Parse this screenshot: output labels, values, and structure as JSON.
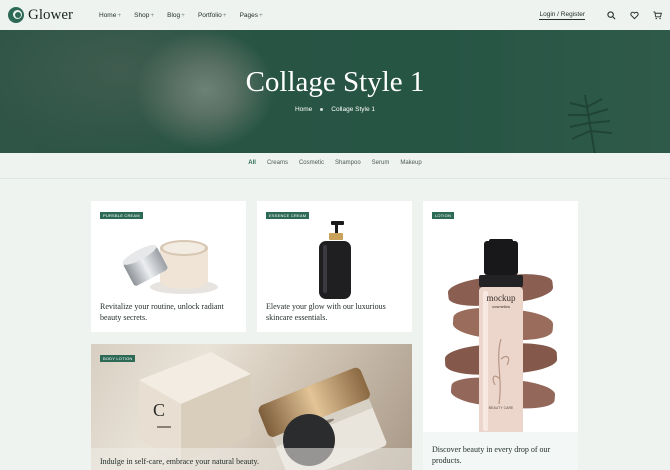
{
  "brand": {
    "name": "Glower"
  },
  "nav": {
    "items": [
      {
        "label": "Home",
        "suffix": "+"
      },
      {
        "label": "Shop",
        "suffix": "+"
      },
      {
        "label": "Blog",
        "suffix": "+"
      },
      {
        "label": "Portfolio",
        "suffix": "+"
      },
      {
        "label": "Pages",
        "suffix": "+"
      }
    ],
    "login_label": "Login / Register"
  },
  "hero": {
    "title": "Collage Style 1",
    "breadcrumb": [
      "Home",
      "Collage Style 1"
    ]
  },
  "filters": [
    "All",
    "Creams",
    "Cosmetic",
    "Shampoo",
    "Serum",
    "Makeup"
  ],
  "cards": [
    {
      "tag": "PURSBLE CREAM",
      "caption": "Revitalize your routine, unlock radiant beauty secrets."
    },
    {
      "tag": "ESSENCE CREAM",
      "caption": "Elevate your glow with our luxurious skincare essentials."
    },
    {
      "tag": "LOTION",
      "caption": "Discover beauty in every drop of our products.",
      "bottle_label": "mockup",
      "bottle_sub": "cosmetics",
      "bottle_bottom": "BEAUTY CARE"
    },
    {
      "tag": "BODY LOTION",
      "caption": "Indulge in self-care, embrace your natural beauty."
    }
  ],
  "colors": {
    "accent": "#2d6a55",
    "background": "#eef3f0"
  }
}
